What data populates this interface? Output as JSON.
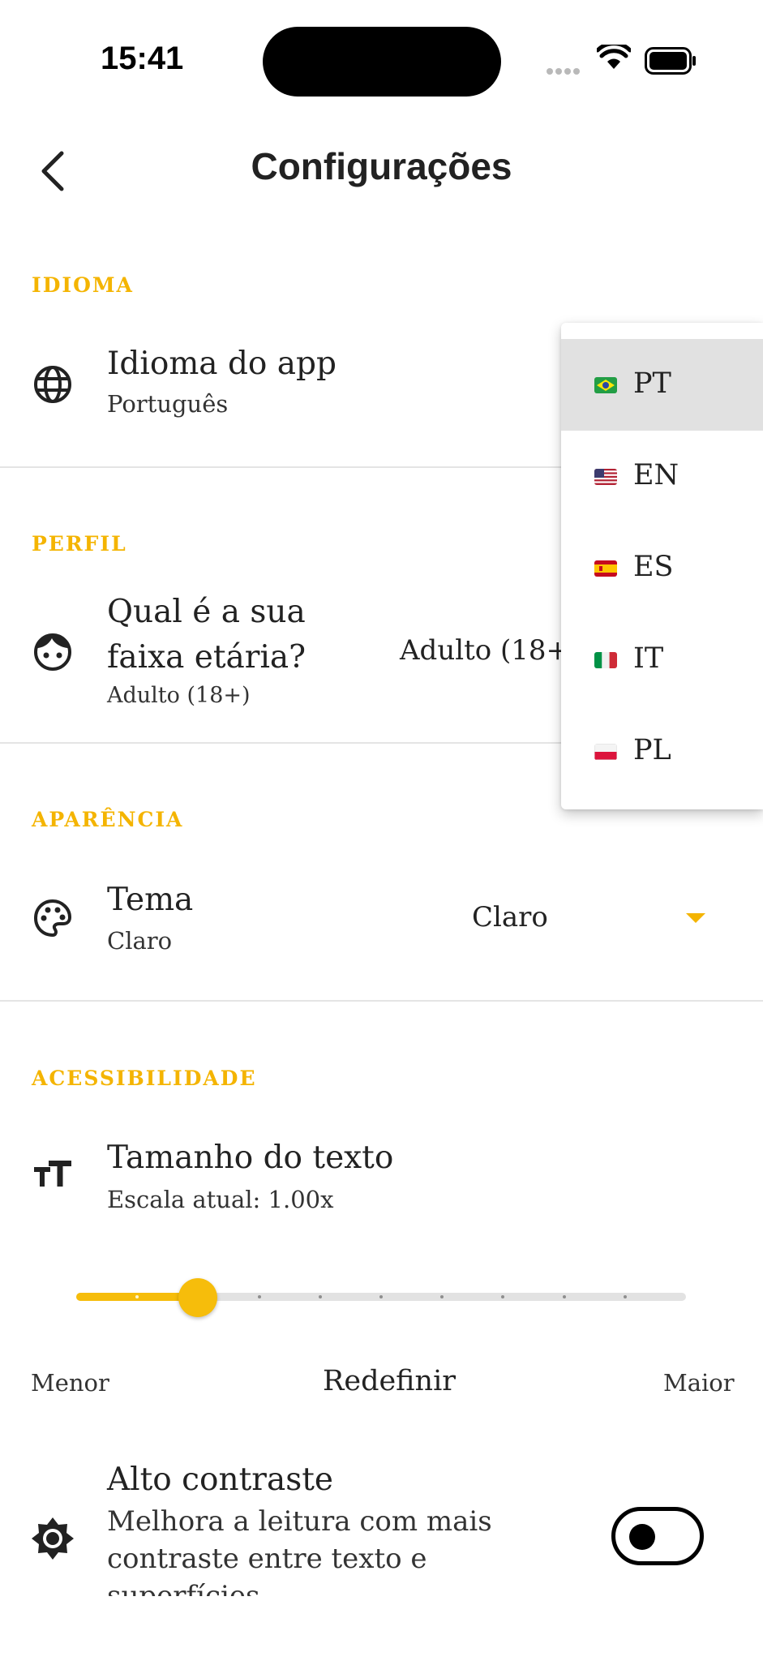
{
  "status_bar": {
    "time": "15:41"
  },
  "header": {
    "title": "Configurações"
  },
  "sections": {
    "language": "IDIOMA",
    "profile": "PERFIL",
    "appearance": "APARÊNCIA",
    "accessibility": "ACESSIBILIDADE"
  },
  "language_row": {
    "title": "Idioma do app",
    "subtitle": "Português"
  },
  "age_row": {
    "title": "Qual é a sua faixa etária?",
    "subtitle": "Adulto (18+)",
    "value": "Adulto (18+)"
  },
  "theme_row": {
    "title": "Tema",
    "subtitle": "Claro",
    "value": "Claro"
  },
  "text_size": {
    "title": "Tamanho do texto",
    "subtitle": "Escala atual: 1.00x",
    "min_label": "Menor",
    "max_label": "Maior",
    "reset_label": "Redefinir",
    "slider": {
      "steps": 10,
      "current_step": 2
    }
  },
  "high_contrast": {
    "title": "Alto contraste",
    "description": "Melhora a leitura com mais contraste entre texto e superfícies",
    "enabled": false
  },
  "language_menu": {
    "selected": "PT",
    "options": [
      {
        "code": "PT",
        "flag": "flag-brazil"
      },
      {
        "code": "EN",
        "flag": "flag-usa"
      },
      {
        "code": "ES",
        "flag": "flag-spain"
      },
      {
        "code": "IT",
        "flag": "flag-italy"
      },
      {
        "code": "PL",
        "flag": "flag-poland"
      }
    ]
  },
  "colors": {
    "accent": "#f4b400",
    "slider": "#f6bd0b",
    "divider": "#e4e4e4",
    "selected_option": "#e1e1e1"
  }
}
